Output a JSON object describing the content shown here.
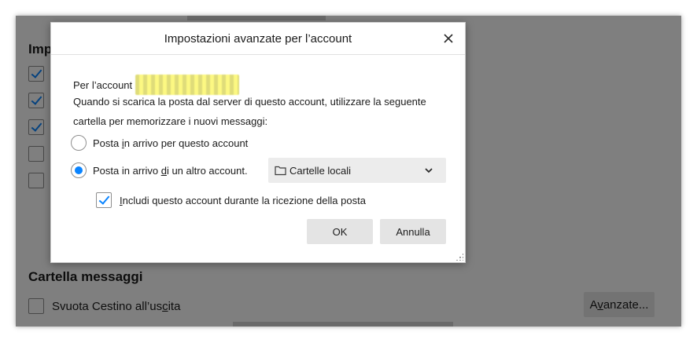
{
  "background": {
    "heading_partial": "Imp",
    "checkboxes": [
      true,
      true,
      true,
      false,
      false
    ],
    "section_title": "Cartella messaggi",
    "empty_trash_label": "Svuota Cestino all’uscita",
    "empty_trash_checked": false,
    "advanced_button_label": "Avanzate..."
  },
  "dialog": {
    "title": "Impostazioni avanzate per l’account",
    "close_icon": "close-icon",
    "account_prefix": "Per l’account",
    "description_line1": "Quando si scarica la posta dal server di questo account, utilizzare la seguente",
    "description_line2": "cartella per memorizzare i nuovi messaggi:",
    "option_this_account": "Posta in arrivo per questo account",
    "option_other_account": "Posta in arrivo di un altro account.",
    "selected_option": "other_account",
    "folder_select_value": "Cartelle locali",
    "include_account_label": "Includi questo account durante la ricezione della posta",
    "include_account_checked": true,
    "ok_label": "OK",
    "cancel_label": "Annulla"
  },
  "colors": {
    "accent": "#0a84ff",
    "overlay": "rgba(0,0,0,0.5)",
    "button_bg": "#e4e4e4"
  }
}
